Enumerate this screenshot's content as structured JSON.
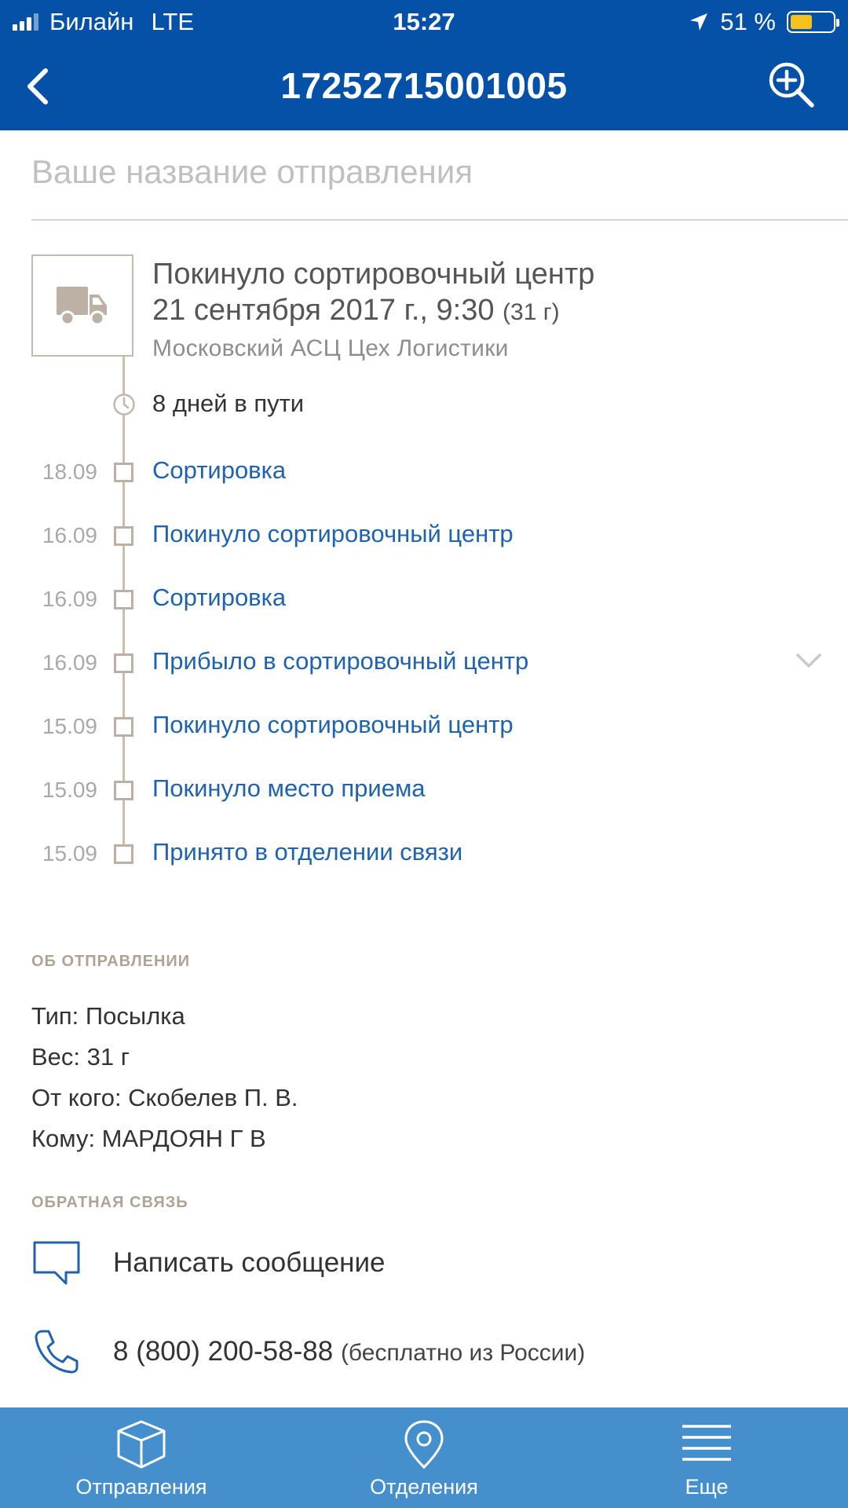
{
  "status_bar": {
    "carrier": "Билайн",
    "network": "LTE",
    "time": "15:27",
    "battery_percent": "51 %",
    "battery_level": 0.51,
    "signal_bars": 3
  },
  "nav": {
    "title": "17252715001005",
    "back_icon": "chevron-left-icon",
    "zoom_icon": "zoom-in-icon"
  },
  "name_field": {
    "placeholder": "Ваше название отправления",
    "value": ""
  },
  "current": {
    "icon": "truck-icon",
    "title": "Покинуло сортировочный центр",
    "date": "21 сентября 2017 г., 9:30",
    "weight": "(31 г)",
    "place": "Московский АСЦ Цех Логистики"
  },
  "transit": {
    "icon": "clock-icon",
    "text": "8 дней в пути"
  },
  "history": [
    {
      "date": "18.09",
      "label": "Сортировка"
    },
    {
      "date": "16.09",
      "label": "Покинуло сортировочный центр"
    },
    {
      "date": "16.09",
      "label": "Сортировка"
    },
    {
      "date": "16.09",
      "label": "Прибыло в сортировочный центр"
    },
    {
      "date": "15.09",
      "label": "Покинуло сортировочный центр"
    },
    {
      "date": "15.09",
      "label": "Покинуло место приема"
    },
    {
      "date": "15.09",
      "label": "Принято в отделении связи"
    }
  ],
  "about": {
    "heading": "ОБ ОТПРАВЛЕНИИ",
    "items": [
      "Тип: Посылка",
      "Вес: 31 г",
      "От кого: Скобелев П. В.",
      "Кому: МАРДОЯН Г В"
    ]
  },
  "feedback": {
    "heading": "ОБРАТНАЯ СВЯЗЬ",
    "message_label": "Написать сообщение",
    "message_icon": "chat-bubble-icon",
    "phone": "8 (800) 200-58-88",
    "phone_note": "(бесплатно из России)",
    "phone_icon": "phone-icon"
  },
  "tabs": [
    {
      "label": "Отправления",
      "icon": "package-box-icon"
    },
    {
      "label": "Отделения",
      "icon": "location-pin-icon"
    },
    {
      "label": "Еще",
      "icon": "menu-lines-icon"
    }
  ],
  "colors": {
    "header": "#0551a8",
    "tabbar": "#448fcc",
    "link": "#1e63b0",
    "timeline": "#c8bdb1",
    "battery": "#f4c21a"
  }
}
